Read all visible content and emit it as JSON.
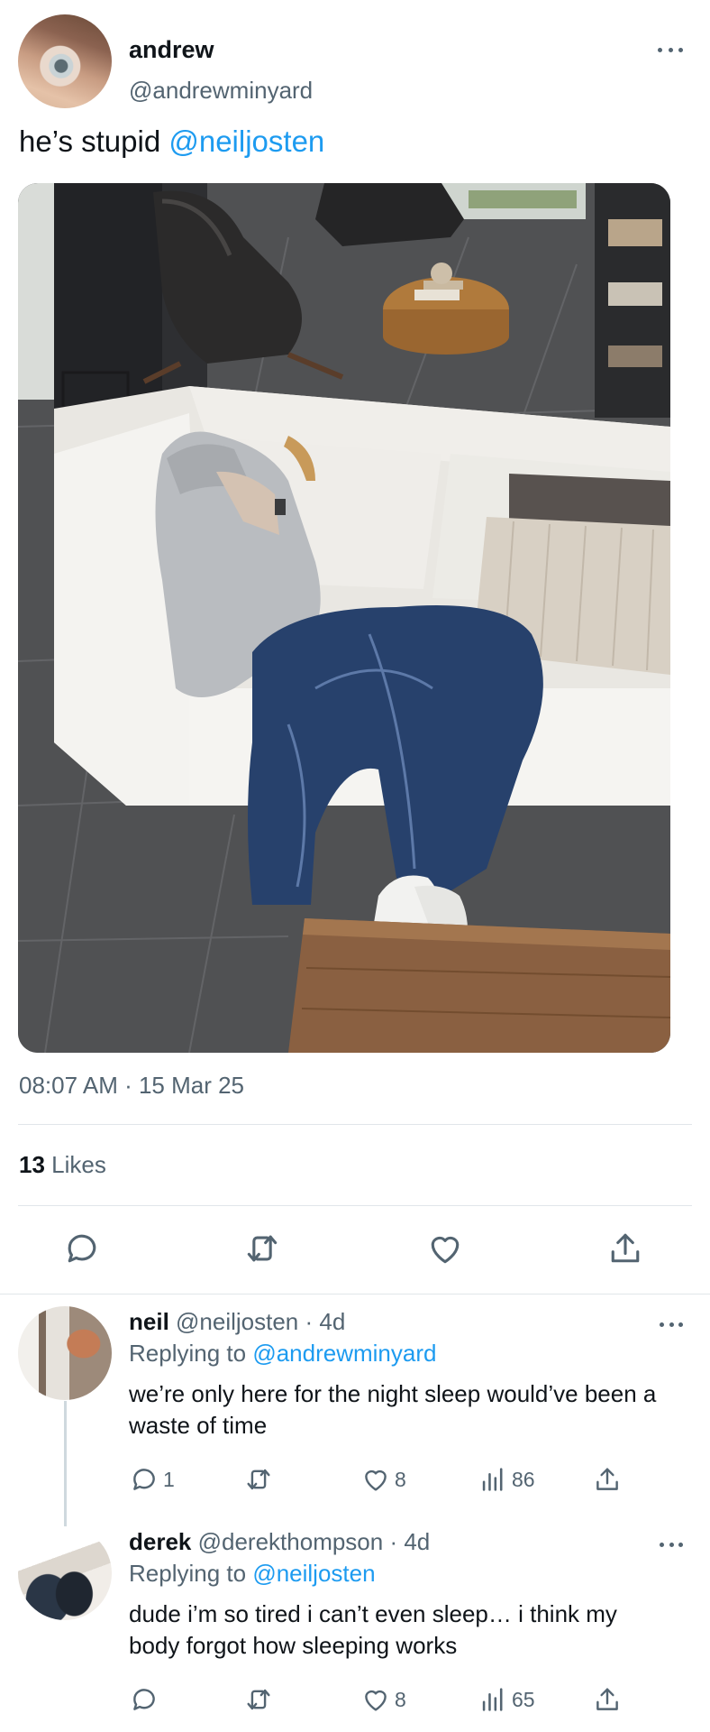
{
  "tweet": {
    "display_name": "andrew",
    "handle": "@andrewminyard",
    "text": "he’s stupid ",
    "mention": "@neiljosten",
    "timestamp": "08:07 AM · 15 Mar 25",
    "likes_count": "13",
    "likes_label": " Likes"
  },
  "replies": [
    {
      "name": "neil",
      "handle_time": " @neiljosten · 4d",
      "replying_label": "Replying to ",
      "replying_to": "@andrewminyard",
      "text": "we’re only here for the night sleep would’ve been a waste of time",
      "reply_count": "1",
      "like_count": "8",
      "view_count": "86"
    },
    {
      "name": "derek",
      "handle_time": " @derekthompson · 4d",
      "replying_label": "Replying to ",
      "replying_to": "@neiljosten",
      "text": "dude i’m so tired i can’t even sleep… i think my body forgot how sleeping works",
      "reply_count": "",
      "like_count": "8",
      "view_count": "65"
    }
  ],
  "icons": {
    "more": "more-dots-icon",
    "reply": "reply-bubble-icon",
    "retweet": "retweet-icon",
    "like": "heart-icon",
    "share": "share-upload-icon",
    "views": "views-bars-icon"
  },
  "colors": {
    "link": "#1d9bf0",
    "secondary_text": "#536471",
    "primary_text": "#0f1419",
    "divider": "#e1e6ea"
  }
}
